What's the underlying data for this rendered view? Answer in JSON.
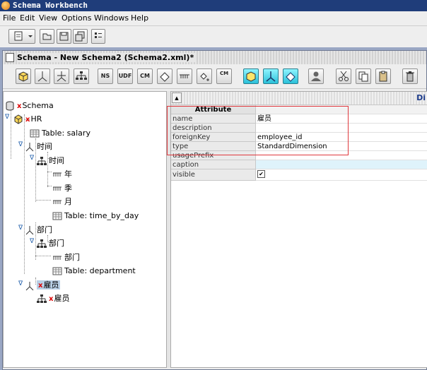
{
  "window": {
    "title": "Schema Workbench"
  },
  "menu": [
    "File",
    "Edit",
    "View",
    "Options",
    "Windows",
    "Help"
  ],
  "doc_window": {
    "title": "Schema - New Schema2 (Schema2.xml)*"
  },
  "toolbar_labels": {
    "ns": "NS",
    "udf": "UDF",
    "cm": "CM",
    "cm2": "CM"
  },
  "tree": [
    {
      "label": "Schema",
      "x_mark": true
    },
    {
      "label": "HR",
      "x_mark": true
    },
    {
      "label": "Table: salary"
    },
    {
      "label": "时间"
    },
    {
      "label": "时间"
    },
    {
      "label": "年"
    },
    {
      "label": "季"
    },
    {
      "label": "月"
    },
    {
      "label": "Table: time_by_day"
    },
    {
      "label": "部门"
    },
    {
      "label": "部门"
    },
    {
      "label": "部门"
    },
    {
      "label": "Table: department"
    },
    {
      "label": "雇员",
      "x_mark": true,
      "selected": true
    },
    {
      "label": "雇员",
      "x_mark": true
    }
  ],
  "properties": {
    "header_title": "Di",
    "column_header": "Attribute",
    "rows": [
      {
        "name": "name",
        "value": "雇员"
      },
      {
        "name": "description",
        "value": ""
      },
      {
        "name": "foreignKey",
        "value": "employee_id"
      },
      {
        "name": "type",
        "value": "StandardDimension"
      },
      {
        "name": "usagePrefix",
        "value": ""
      },
      {
        "name": "caption",
        "value": ""
      },
      {
        "name": "visible",
        "value": "✔"
      }
    ]
  }
}
